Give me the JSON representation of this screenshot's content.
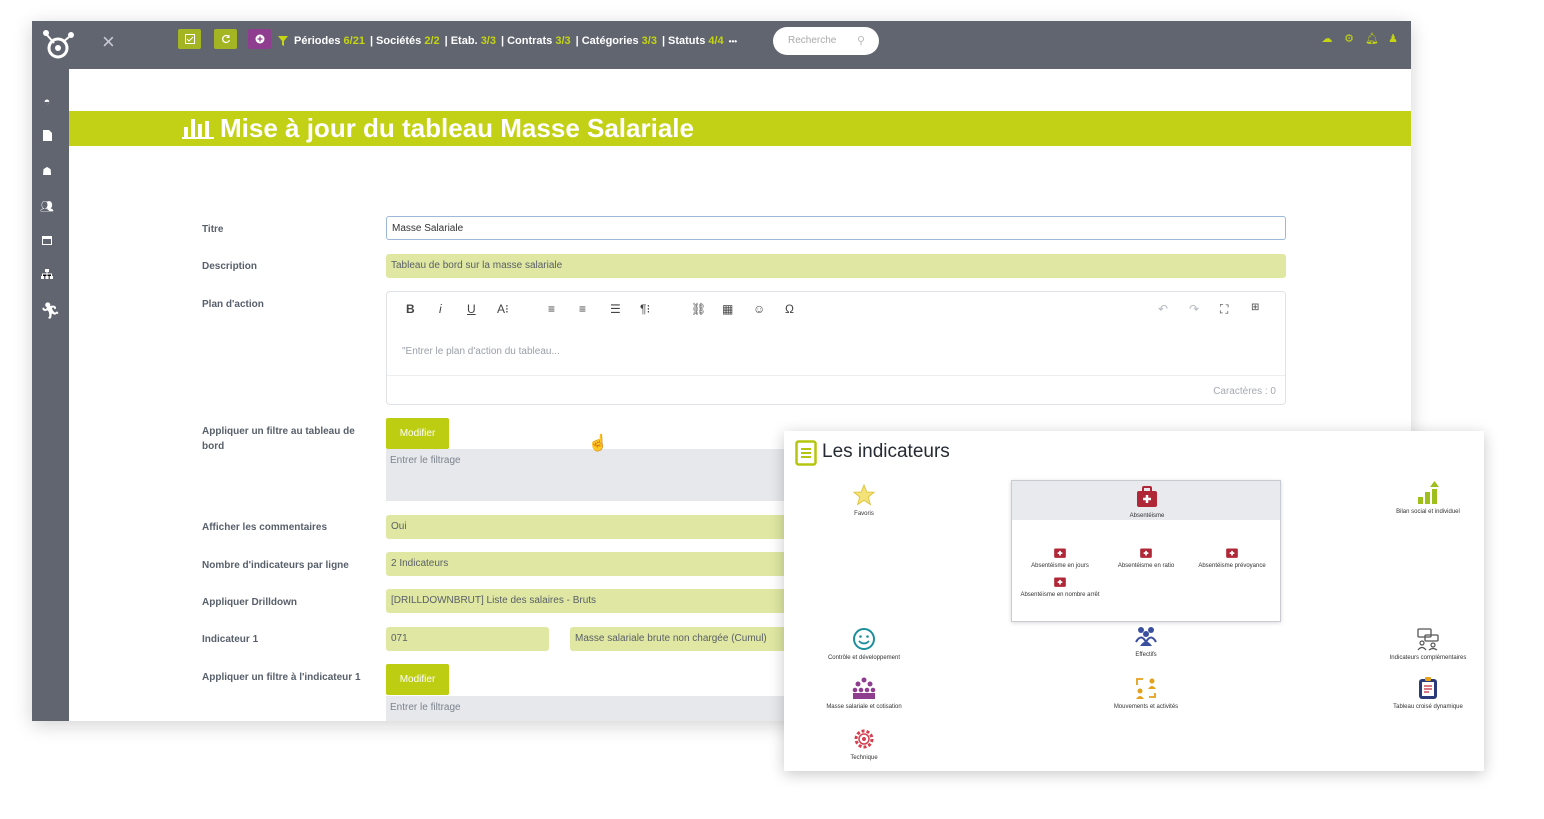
{
  "topbar": {
    "close_label": "×",
    "filters": [
      {
        "label": "Périodes",
        "count": "6/21"
      },
      {
        "label": "Sociétés",
        "count": "2/2"
      },
      {
        "label": "Etab.",
        "count": "3/3"
      },
      {
        "label": "Contrats",
        "count": "3/3"
      },
      {
        "label": "Catégories",
        "count": "3/3"
      },
      {
        "label": "Statuts",
        "count": "4/4"
      }
    ],
    "more_label": "•••",
    "search_placeholder": "Recherche",
    "colors": {
      "bar": "#60656f",
      "accent": "#c5d511",
      "purple": "#8e3d8f"
    }
  },
  "page": {
    "title": "Mise à jour du tableau Masse Salariale"
  },
  "form": {
    "titre_label": "Titre",
    "titre_value": "Masse Salariale",
    "description_label": "Description",
    "description_value": "Tableau de bord sur la masse salariale",
    "plan_label": "Plan d'action",
    "plan_placeholder": "\"Entrer le plan d'action du tableau...",
    "plan_counter": "Caractères : 0",
    "filtre_label": "Appliquer un filtre au tableau de bord",
    "modifier_label": "Modifier",
    "filtre_placeholder": "Entrer le filtrage",
    "commentaires_label": "Afficher les commentaires",
    "commentaires_value": "Oui",
    "nb_indicateurs_label": "Nombre d'indicateurs par ligne",
    "nb_indicateurs_value": "2 Indicateurs",
    "drilldown_label": "Appliquer Drilldown",
    "drilldown_value": "[DRILLDOWNBRUT] Liste des salaires - Bruts",
    "indicateur1_label": "Indicateur 1",
    "indicateur1_code": "071",
    "indicateur1_value": "Masse salariale brute non chargée (Cumul)",
    "filtre_ind1_label": "Appliquer un filtre à l'indicateur 1",
    "modifier2_label": "Modifier",
    "filtre_ind1_placeholder": "Entrer le filtrage"
  },
  "panel": {
    "title": "Les indicateurs",
    "items": {
      "favoris": "Favoris",
      "absenteisme": "Absentéisme",
      "bilan": "Bilan social et individuel",
      "controle": "Contrôle et développement",
      "effectifs": "Effectifs",
      "complementaires": "Indicateurs complémentaires",
      "masse": "Masse salariale et cotisation",
      "mouvements": "Mouvements et activités",
      "tableau_croise": "Tableau croisé dynamique",
      "technique": "Technique"
    },
    "sub_items": {
      "jours": "Absentéisme en jours",
      "ratio": "Absentéisme en ratio",
      "prevoyance": "Absentéisme prévoyance",
      "nombre": "Absentéisme en nombre arrêt"
    }
  }
}
